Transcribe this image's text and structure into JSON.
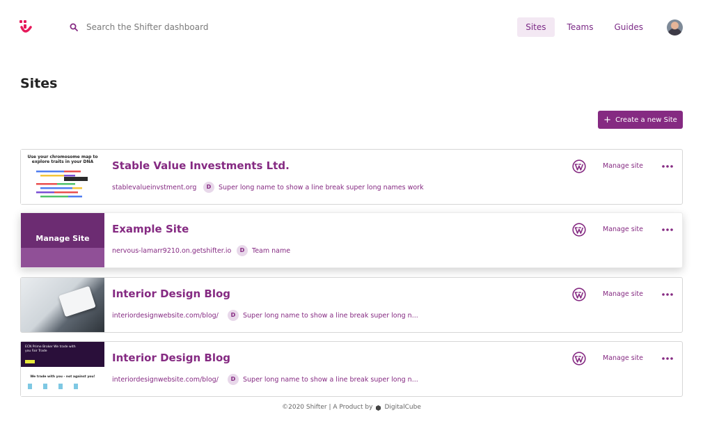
{
  "header": {
    "search_placeholder": "Search the Shifter dashboard",
    "nav": [
      {
        "label": "Sites",
        "active": true
      },
      {
        "label": "Teams",
        "active": false
      },
      {
        "label": "Guides",
        "active": false
      }
    ]
  },
  "page": {
    "title": "Sites",
    "create_button": "Create a new Site"
  },
  "sites": [
    {
      "name": "Stable Value Investments Ltd.",
      "domain": "stablevalueinvstment.org",
      "team_initial": "D",
      "team_name": "Super long name to show a line break super long names work",
      "manage_label": "Manage site",
      "thumbnail_text": "Use your chromosome map to explore traits in your DNA"
    },
    {
      "name": "Example Site",
      "domain": "nervous-lamarr9210.on.getshifter.io",
      "team_initial": "D",
      "team_name": "Team name",
      "manage_label": "Manage site",
      "thumbnail_overlay": "Manage Site"
    },
    {
      "name": "Interior Design Blog",
      "domain": "interiordesignwebsite.com/blog/",
      "team_initial": "D",
      "team_name": "Super long name to show a line break super long n...",
      "manage_label": "Manage site"
    },
    {
      "name": "Interior Design Blog",
      "domain": "interiordesignwebsite.com/blog/",
      "team_initial": "D",
      "team_name": "Super long name to show a line break super long n...",
      "manage_label": "Manage site",
      "thumbnail_text": "ECN Prime Broker We trade with you Fair Trade",
      "thumbnail_tagline": "We trade with you - not against you!"
    }
  ],
  "footer": {
    "text": "©2020 Shifter | A Product by",
    "brand": "DigitalCube"
  },
  "colors": {
    "accent": "#852a82",
    "logo": "#e6195a",
    "active_nav_bg": "#f3e8f3"
  }
}
